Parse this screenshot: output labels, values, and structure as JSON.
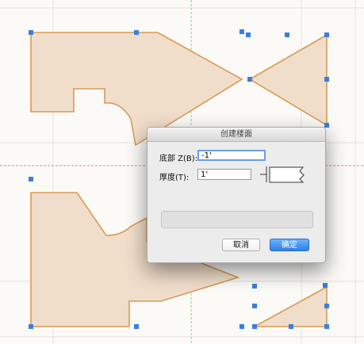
{
  "dialog": {
    "title": "创建楼面",
    "bottom_label": "底部 Z(B):",
    "bottom_value": "-1'",
    "thickness_label": "厚度(T):",
    "thickness_value": "1'",
    "cancel_label": "取消",
    "ok_label": "确定"
  },
  "colors": {
    "shape_fill": "#f0ddca",
    "shape_stroke": "#d99a55",
    "handle": "#3a7ee0",
    "grid": "#e3e1da",
    "guide_red": "#f08080",
    "guide_green": "#7fd67f",
    "primary_button": "#3b86ea"
  }
}
